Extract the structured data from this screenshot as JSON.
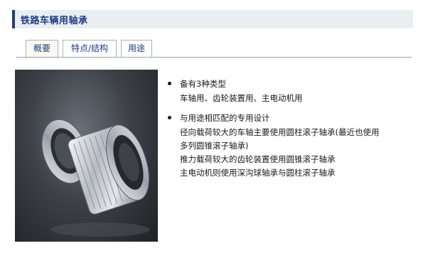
{
  "page": {
    "title": "铁路车辆用轴承"
  },
  "tabs": [
    {
      "label": "概要",
      "active": true
    },
    {
      "label": "特点/结构",
      "active": false
    },
    {
      "label": "用途",
      "active": false
    }
  ],
  "features": [
    {
      "title": "备有3种类型",
      "lines": [
        "车轴用、齿轮装置用、主电动机用"
      ]
    },
    {
      "title": "与用途相匹配的专用设计",
      "lines": [
        "径向载荷较大的车轴主要使用圆柱滚子轴承(最近也使用",
        "多列圆锥滚子轴承)",
        "推力载荷较大的齿轮装置使用圆锥滚子轴承",
        "主电动机则使用深沟球轴承与圆柱滚子轴承"
      ]
    }
  ],
  "colors": {
    "title_accent": "#243d7a",
    "title_bg": "#e9eef3",
    "tab_active_bg": "#fbf8ef",
    "link_text": "#1f3a80"
  }
}
